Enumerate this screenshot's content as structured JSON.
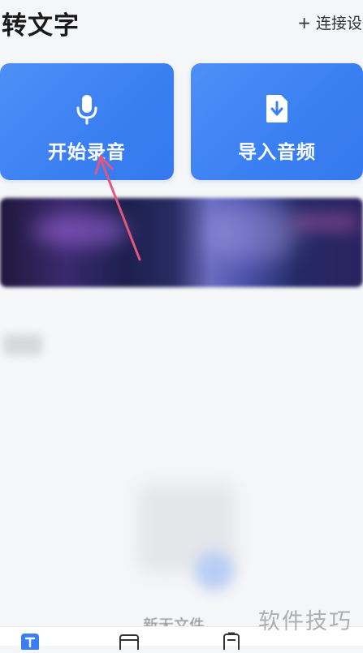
{
  "header": {
    "title": "转文字",
    "connect_label": "连接设备",
    "plus_icon": "+"
  },
  "actions": {
    "record_label": "开始录音",
    "record_icon": "microphone-icon",
    "import_label": "导入音频",
    "import_icon": "import-file-icon"
  },
  "empty_state": {
    "new_file_label": "新无文件"
  },
  "watermark": "软件技巧",
  "colors": {
    "card_blue": "#3a7ff2",
    "annotation_arrow": "#e0587a"
  }
}
